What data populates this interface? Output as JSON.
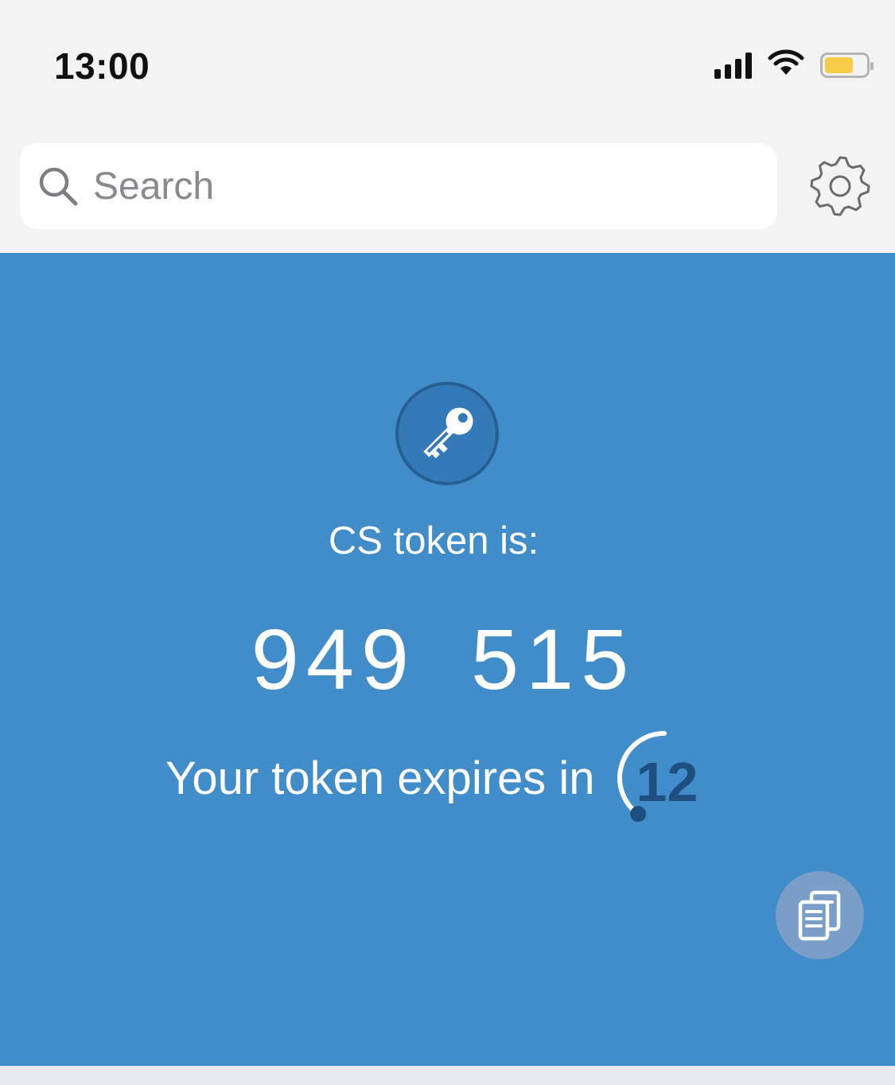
{
  "status_bar": {
    "time": "13:00",
    "battery_level": 0.7
  },
  "search": {
    "placeholder": "Search",
    "value": ""
  },
  "token": {
    "label": "CS token is:",
    "code": "949 515",
    "expires_label": "Your token expires in",
    "seconds_remaining": "12",
    "countdown_fraction": 0.4
  },
  "icons": {
    "search": "search-icon",
    "settings": "gear-icon",
    "key": "key-icon",
    "copy": "copy-icon",
    "signal": "cellular-signal-icon",
    "wifi": "wifi-icon",
    "battery": "battery-icon"
  },
  "colors": {
    "panel_blue": "#418dca",
    "key_badge": "#3479b8",
    "key_badge_border": "#275f93",
    "countdown_navy": "#1f4f80",
    "copy_button": "#7b9ec9",
    "battery_yellow": "#f5cd46",
    "icon_gray": "#6b6b6b"
  }
}
